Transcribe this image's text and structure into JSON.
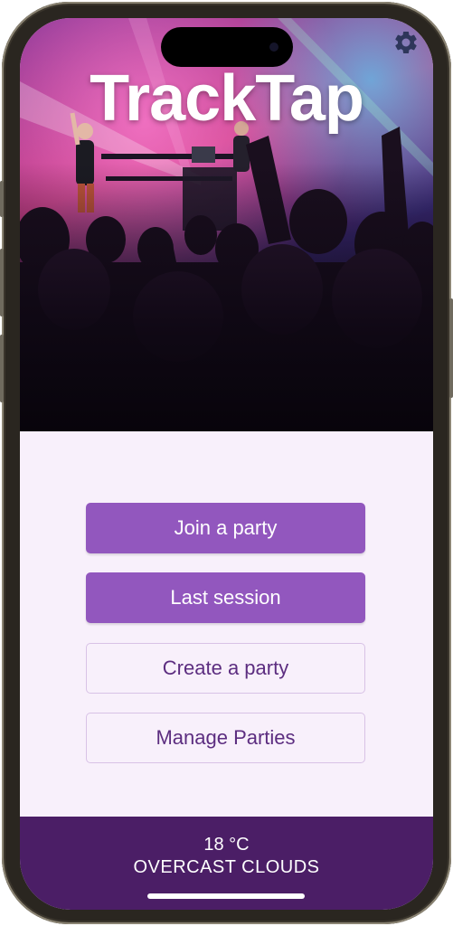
{
  "app": {
    "title": "TrackTap"
  },
  "menu": {
    "join_label": "Join a party",
    "last_session_label": "Last session",
    "create_label": "Create a party",
    "manage_label": "Manage Parties"
  },
  "weather": {
    "temperature": "18 °C",
    "condition": "OVERCAST CLOUDS"
  },
  "icons": {
    "settings": "gear-icon"
  },
  "colors": {
    "primary_button": "#9257be",
    "outline_border": "#d8c2e6",
    "weather_bar": "#4b1e66",
    "background": "#f8f0fb"
  }
}
